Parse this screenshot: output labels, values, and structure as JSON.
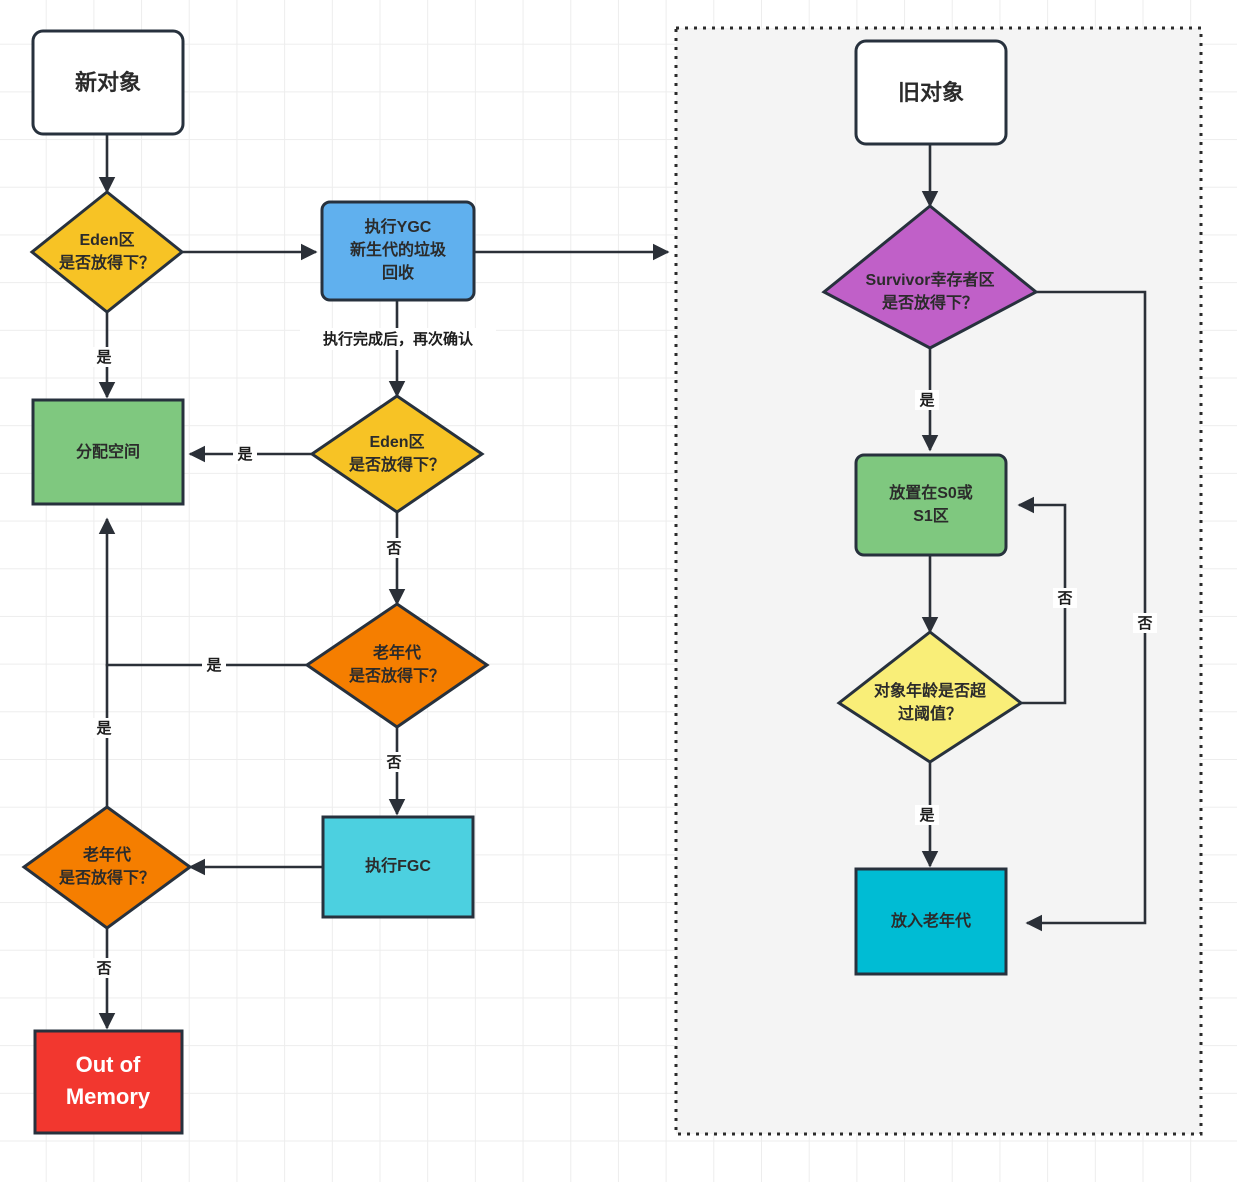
{
  "diagram": {
    "title_hidden": "JVM 对象分配与垃圾回收流程图",
    "colors": {
      "amber": "#F7C325",
      "orange": "#F57E00",
      "green": "#7FC87F",
      "blue": "#60B0EE",
      "cyan_light": "#4CD0E0",
      "cyan_strong": "#00BCD4",
      "purple": "#C060C8",
      "yellow": "#F9EE78",
      "red": "#F2372F",
      "white": "#FFFFFF",
      "stroke": "#27313D",
      "group_fill": "#F4F4F4",
      "grid": "#EDEDED"
    },
    "left_flow": {
      "nodes": [
        {
          "id": "new-object",
          "label": "新对象",
          "shape": "rounded-rect",
          "color": "#FFFFFF"
        },
        {
          "id": "eden-check-1",
          "label_line1": "Eden区",
          "label_line2": "是否放得下？",
          "shape": "diamond",
          "color": "#F7C325"
        },
        {
          "id": "run-ygc",
          "label_line1": "执行YGC",
          "label_line2": "新生代的垃圾",
          "label_line3": "回收",
          "shape": "rounded-rect",
          "color": "#60B0EE"
        },
        {
          "id": "allocate-space",
          "label": "分配空间",
          "shape": "rect",
          "color": "#7FC87F"
        },
        {
          "id": "eden-check-2",
          "label_line1": "Eden区",
          "label_line2": "是否放得下？",
          "shape": "diamond",
          "color": "#F7C325"
        },
        {
          "id": "oldgen-check-1",
          "label_line1": "老年代",
          "label_line2": "是否放得下？",
          "shape": "diamond",
          "color": "#F57E00"
        },
        {
          "id": "run-fgc",
          "label": "执行FGC",
          "shape": "rect",
          "color": "#4CD0E0"
        },
        {
          "id": "oldgen-check-2",
          "label_line1": "老年代",
          "label_line2": "是否放得下？",
          "shape": "diamond",
          "color": "#F57E00"
        },
        {
          "id": "out-of-memory",
          "label_line1": "Out of",
          "label_line2": "Memory",
          "shape": "rect",
          "color": "#F2372F"
        }
      ],
      "edges": [
        {
          "from": "new-object",
          "to": "eden-check-1",
          "label": ""
        },
        {
          "from": "eden-check-1",
          "to": "run-ygc",
          "label": ""
        },
        {
          "from": "eden-check-1",
          "to": "allocate-space",
          "label": "是"
        },
        {
          "from": "run-ygc",
          "to": "eden-check-2",
          "label": "执行完成后，再次确认"
        },
        {
          "from": "run-ygc",
          "to": "old-object-group",
          "label": ""
        },
        {
          "from": "eden-check-2",
          "to": "allocate-space",
          "label": "是"
        },
        {
          "from": "eden-check-2",
          "to": "oldgen-check-1",
          "label": "否"
        },
        {
          "from": "oldgen-check-1",
          "to": "allocate-space",
          "label": "是"
        },
        {
          "from": "oldgen-check-1",
          "to": "run-fgc",
          "label": "否"
        },
        {
          "from": "run-fgc",
          "to": "oldgen-check-2",
          "label": ""
        },
        {
          "from": "oldgen-check-2",
          "to": "allocate-space",
          "label": "是"
        },
        {
          "from": "oldgen-check-2",
          "to": "out-of-memory",
          "label": "否"
        }
      ]
    },
    "right_group": {
      "nodes": [
        {
          "id": "old-object",
          "label": "旧对象",
          "shape": "rounded-rect",
          "color": "#FFFFFF"
        },
        {
          "id": "survivor-check",
          "label_line1": "Survivor幸存者区",
          "label_line2": "是否放得下？",
          "shape": "diamond",
          "color": "#C060C8"
        },
        {
          "id": "place-s0-s1",
          "label_line1": "放置在S0或",
          "label_line2": "S1区",
          "shape": "rounded-rect",
          "color": "#7FC87F"
        },
        {
          "id": "age-threshold-check",
          "label_line1": "对象年龄是否超",
          "label_line2": "过阈值？",
          "shape": "diamond",
          "color": "#F9EE78"
        },
        {
          "id": "move-to-oldgen",
          "label": "放入老年代",
          "shape": "rect",
          "color": "#00BCD4"
        }
      ],
      "edges": [
        {
          "from": "old-object",
          "to": "survivor-check",
          "label": ""
        },
        {
          "from": "survivor-check",
          "to": "place-s0-s1",
          "label": "是"
        },
        {
          "from": "survivor-check",
          "to": "move-to-oldgen",
          "label": "否"
        },
        {
          "from": "place-s0-s1",
          "to": "age-threshold-check",
          "label": ""
        },
        {
          "from": "age-threshold-check",
          "to": "place-s0-s1",
          "label": "否"
        },
        {
          "from": "age-threshold-check",
          "to": "move-to-oldgen",
          "label": "是"
        }
      ]
    },
    "labels": {
      "yes": "是",
      "no": "否",
      "after_exec_reconfirm": "执行完成后，再次确认"
    }
  }
}
